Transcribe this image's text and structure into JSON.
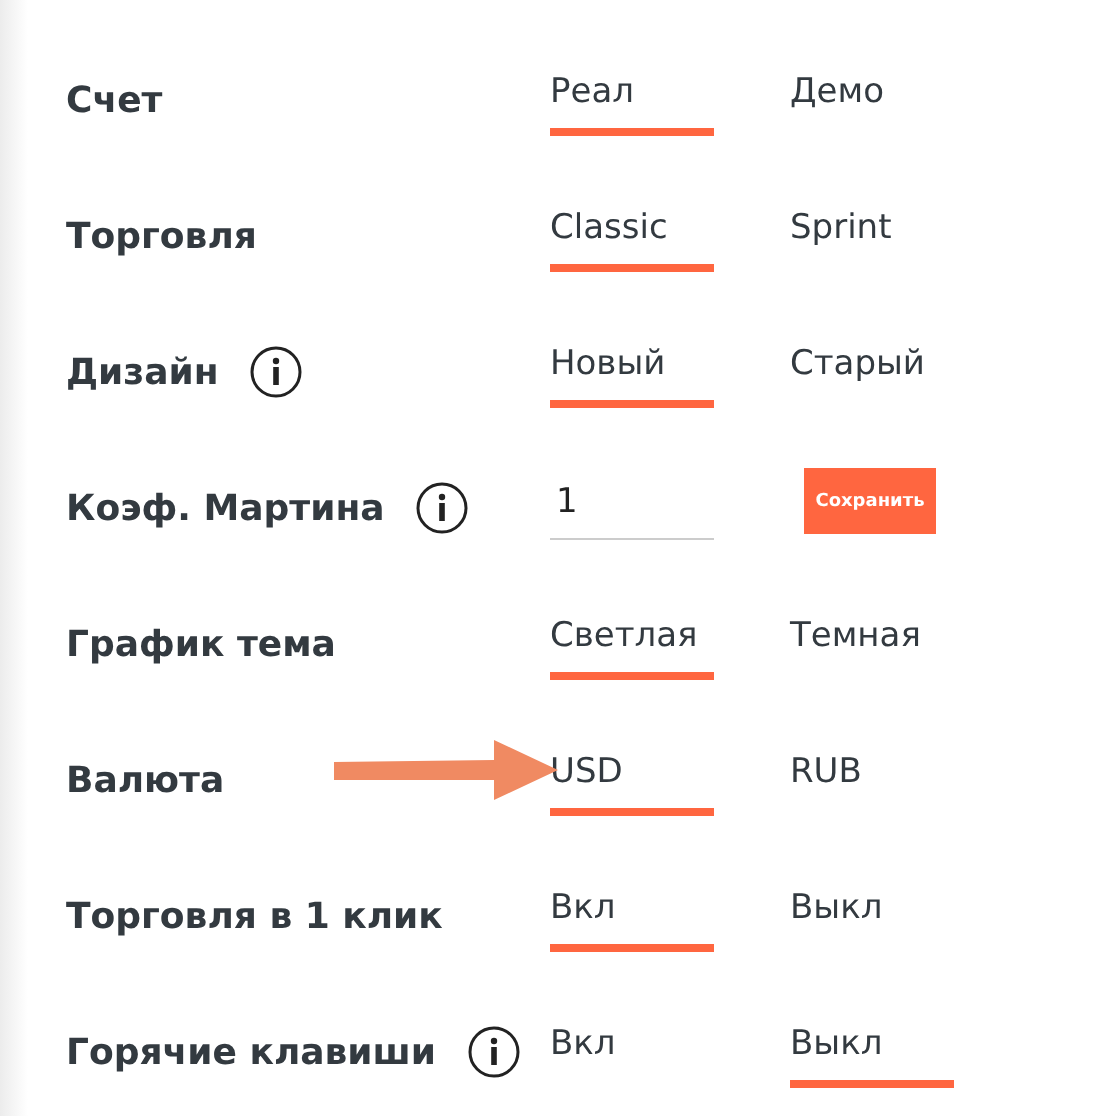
{
  "settings": [
    {
      "kind": "options",
      "label": "Счет",
      "info": false,
      "arrow": false,
      "options": [
        {
          "label": "Реал",
          "selected": true
        },
        {
          "label": "Демо",
          "selected": false
        }
      ]
    },
    {
      "kind": "options",
      "label": "Торговля",
      "info": false,
      "arrow": false,
      "options": [
        {
          "label": "Classic",
          "selected": true
        },
        {
          "label": "Sprint",
          "selected": false
        }
      ]
    },
    {
      "kind": "options",
      "label": "Дизайн",
      "info": true,
      "arrow": false,
      "options": [
        {
          "label": "Новый",
          "selected": true
        },
        {
          "label": "Старый",
          "selected": false
        }
      ]
    },
    {
      "kind": "input",
      "label": "Коэф. Мартина",
      "info": true,
      "arrow": false,
      "value": "1",
      "button": "Сохранить"
    },
    {
      "kind": "options",
      "label": "График тема",
      "info": false,
      "arrow": false,
      "options": [
        {
          "label": "Светлая",
          "selected": true
        },
        {
          "label": "Темная",
          "selected": false
        }
      ]
    },
    {
      "kind": "options",
      "label": "Валюта",
      "info": false,
      "arrow": true,
      "options": [
        {
          "label": "USD",
          "selected": true
        },
        {
          "label": "RUB",
          "selected": false
        }
      ]
    },
    {
      "kind": "options",
      "label": "Торговля в 1 клик",
      "info": false,
      "arrow": false,
      "options": [
        {
          "label": "Вкл",
          "selected": true
        },
        {
          "label": "Выкл",
          "selected": false
        }
      ]
    },
    {
      "kind": "options",
      "label": "Горячие клавиши",
      "info": true,
      "arrow": false,
      "options": [
        {
          "label": "Вкл",
          "selected": false
        },
        {
          "label": "Выкл",
          "selected": true
        }
      ]
    }
  ]
}
